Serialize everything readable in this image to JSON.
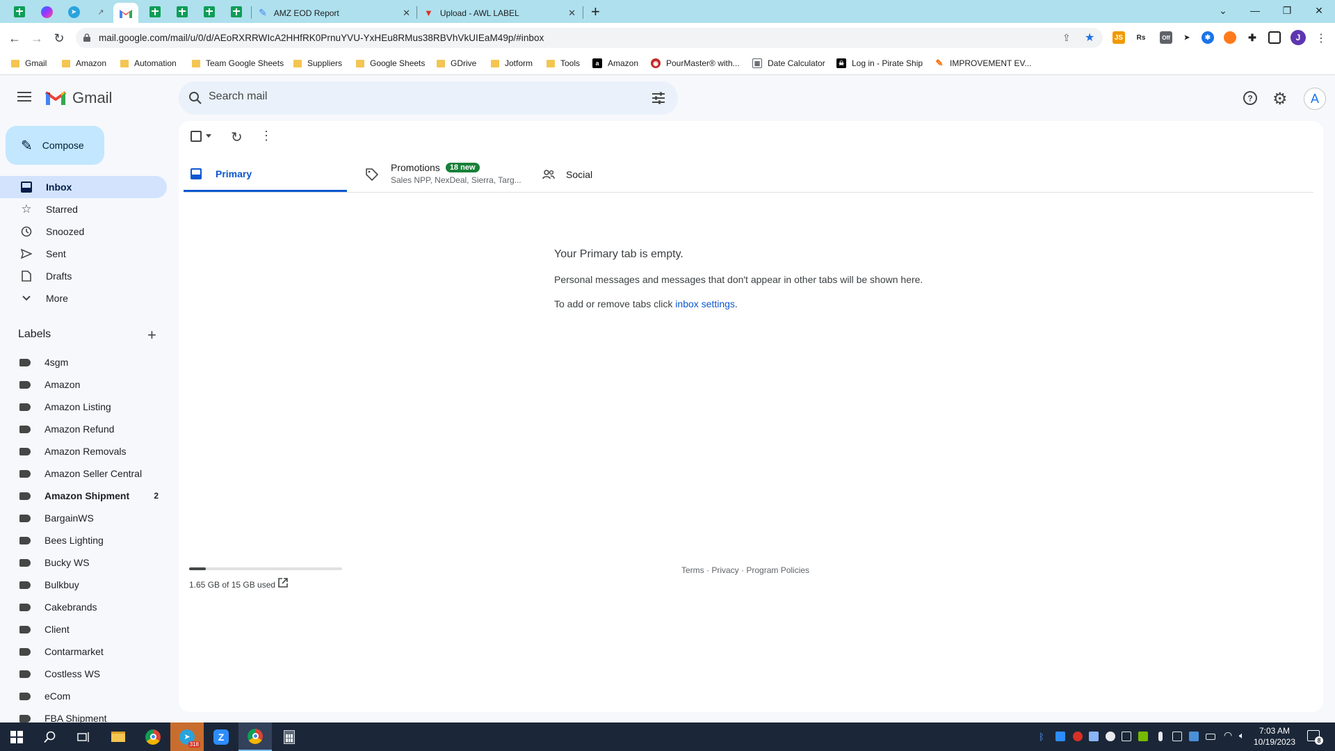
{
  "browser": {
    "tabs": [
      {
        "title": "AMZ EOD Report"
      },
      {
        "title": "Upload - AWL LABEL"
      }
    ],
    "url": "mail.google.com/mail/u/0/d/AEoRXRRWIcA2HHfRK0PrnuYVU-YxHEu8RMus38RBVhVkUIEaM49p/#inbox",
    "bookmarks": [
      {
        "label": "Gmail",
        "icon": "folder"
      },
      {
        "label": "Amazon",
        "icon": "folder"
      },
      {
        "label": "Automation",
        "icon": "folder"
      },
      {
        "label": "Team Google Sheets",
        "icon": "folder"
      },
      {
        "label": "Suppliers",
        "icon": "folder"
      },
      {
        "label": "Google Sheets",
        "icon": "folder"
      },
      {
        "label": "GDrive",
        "icon": "folder"
      },
      {
        "label": "Jotform",
        "icon": "folder"
      },
      {
        "label": "Tools",
        "icon": "folder"
      },
      {
        "label": "Amazon",
        "icon": "amazon"
      },
      {
        "label": "PourMaster® with...",
        "icon": "pourmaster"
      },
      {
        "label": "Date Calculator",
        "icon": "calculator"
      },
      {
        "label": "Log in - Pirate Ship",
        "icon": "pirate-ship"
      },
      {
        "label": "IMPROVEMENT EV...",
        "icon": "improvement"
      }
    ],
    "profile_initial": "J"
  },
  "gmail": {
    "brand": "Gmail",
    "search_placeholder": "Search mail",
    "compose_label": "Compose",
    "account_initial": "A",
    "nav": [
      {
        "label": "Inbox",
        "icon": "inbox-icon",
        "selected": true
      },
      {
        "label": "Starred",
        "icon": "star-icon"
      },
      {
        "label": "Snoozed",
        "icon": "clock-icon"
      },
      {
        "label": "Sent",
        "icon": "send-icon"
      },
      {
        "label": "Drafts",
        "icon": "draft-icon"
      },
      {
        "label": "More",
        "icon": "chevron-down-icon"
      }
    ],
    "labels_heading": "Labels",
    "labels": [
      {
        "name": "4sgm"
      },
      {
        "name": "Amazon"
      },
      {
        "name": "Amazon Listing"
      },
      {
        "name": "Amazon Refund"
      },
      {
        "name": "Amazon Removals"
      },
      {
        "name": "Amazon Seller Central"
      },
      {
        "name": "Amazon Shipment",
        "count": "2",
        "bold": true
      },
      {
        "name": "BargainWS"
      },
      {
        "name": "Bees Lighting"
      },
      {
        "name": "Bucky WS"
      },
      {
        "name": "Bulkbuy"
      },
      {
        "name": "Cakebrands"
      },
      {
        "name": "Client"
      },
      {
        "name": "Contarmarket"
      },
      {
        "name": "Costless WS"
      },
      {
        "name": "eCom"
      },
      {
        "name": "FBA Shipment"
      }
    ],
    "tabs": {
      "primary": "Primary",
      "promotions": "Promotions",
      "promotions_badge": "18 new",
      "promotions_snippet": "Sales NPP, NexDeal, Sierra, Targ...",
      "social": "Social"
    },
    "empty": {
      "title": "Your Primary tab is empty.",
      "line1": "Personal messages and messages that don't appear in other tabs will be shown here.",
      "line2_prefix": "To add or remove tabs click ",
      "line2_link": "inbox settings",
      "line2_suffix": "."
    },
    "storage": {
      "text": "1.65 GB of 15 GB used",
      "fraction": 0.11
    },
    "footer_links": {
      "terms": "Terms",
      "sep1": " · ",
      "privacy": "Privacy",
      "sep2": " · ",
      "policies": "Program Policies"
    }
  },
  "taskbar": {
    "time": "7:03 AM",
    "date": "10/19/2023",
    "telegram_badge": "318",
    "notification_count": "8"
  }
}
